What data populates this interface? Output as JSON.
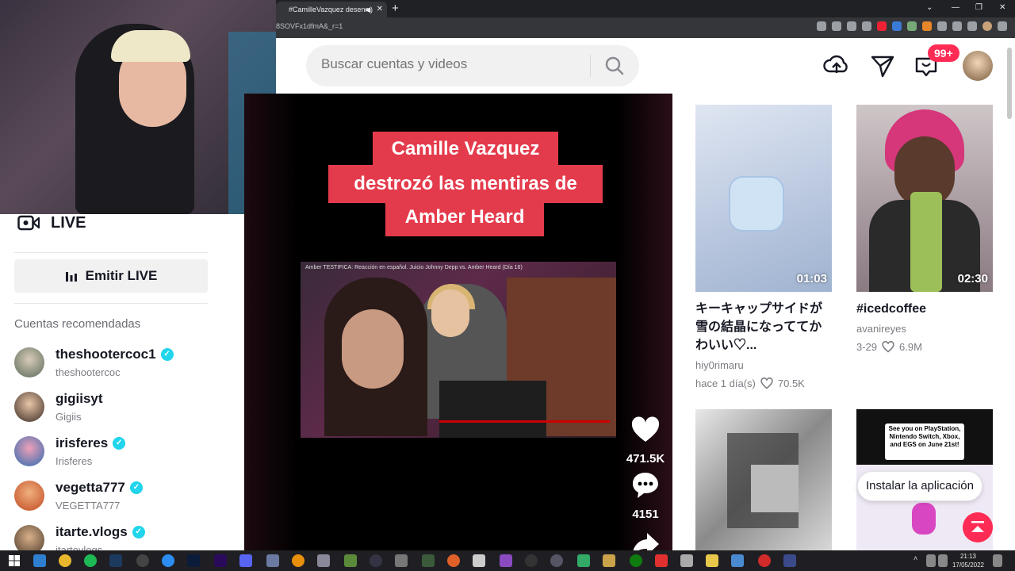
{
  "browser": {
    "tab_title": "#CamilleVazquez desenm",
    "tab_audio_icon": "speaker-icon",
    "url_text": "8SOVFx1dfmA&_r=1"
  },
  "header": {
    "search_placeholder": "Buscar cuentas y videos",
    "notification_badge": "99+"
  },
  "sidebar": {
    "live_label": "LIVE",
    "emitir_label": "Emitir LIVE",
    "recommended_title": "Cuentas recomendadas",
    "accounts": [
      {
        "name": "theshootercoc1",
        "handle": "theshootercoc",
        "verified": true
      },
      {
        "name": "gigiisyt",
        "handle": "Gigiis",
        "verified": false
      },
      {
        "name": "irisferes",
        "handle": "Irisferes",
        "verified": true
      },
      {
        "name": "vegetta777",
        "handle": "VEGETTA777",
        "verified": true
      },
      {
        "name": "itarte.vlogs",
        "handle": "itartevlogs",
        "verified": true
      }
    ]
  },
  "player": {
    "overlay_lines": [
      "Camille Vazquez",
      "destrozó las mentiras de",
      "Amber Heard"
    ],
    "embedded_caption": "Amber TESTIFICA: Reacción en español. Juicio Johnny Depp vs. Amber Heard (Día 16)",
    "likes": "471.5K",
    "comments": "4151"
  },
  "feed": [
    {
      "duration": "01:03",
      "title": "キーキャップサイドが雪の結晶になっててかわいい♡...",
      "author": "hiy0rimaru",
      "meta": "hace 1 día(s)",
      "likes": "70.5K"
    },
    {
      "duration": "02:30",
      "title": "#icedcoffee",
      "author": "avanireyes",
      "meta": "3-29",
      "likes": "6.9M"
    },
    {
      "duration": "",
      "title": "",
      "author": "",
      "meta": "",
      "likes": ""
    },
    {
      "duration": "",
      "title": "See you on PlayStation, Nintendo Switch, Xbox, and EGS on June 21st!",
      "author": "",
      "meta": "",
      "likes": ""
    }
  ],
  "install_label": "Instalar la aplicación",
  "taskbar": {
    "time": "21:13",
    "date": "17/05/2022"
  },
  "colors": {
    "brand": "#fe2c55",
    "verified": "#20d5ec",
    "overlay_red": "#e43b4c"
  }
}
